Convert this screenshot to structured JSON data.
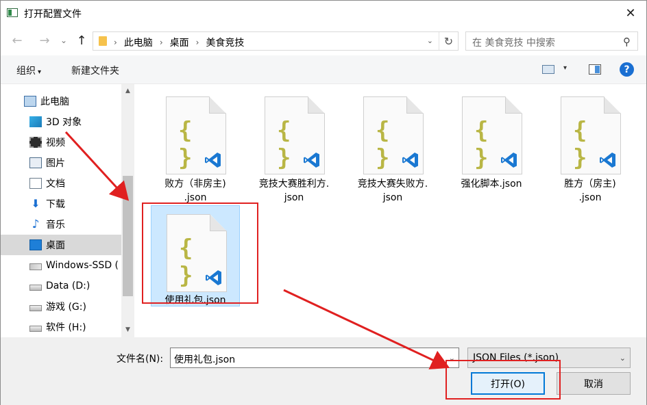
{
  "window": {
    "title": "打开配置文件",
    "close_glyph": "✕"
  },
  "nav": {
    "back_glyph": "←",
    "forward_glyph": "→",
    "recent_glyph": "⌄",
    "up_glyph": "↑",
    "breadcrumb": [
      "此电脑",
      "桌面",
      "美食竞技"
    ],
    "breadcrumb_sep": "›",
    "address_dropdown_glyph": "⌄",
    "refresh_glyph": "↻",
    "search_placeholder": "在 美食竞技 中搜索",
    "search_glyph": "⚲"
  },
  "toolbar": {
    "organize_label": "组织",
    "organize_arrow": "▾",
    "new_folder_label": "新建文件夹",
    "view_dropdown_glyph": "▾",
    "help_label": "?"
  },
  "sidebar": {
    "items": [
      {
        "label": "此电脑",
        "icon": "computer-icon"
      },
      {
        "label": "3D 对象",
        "icon": "3d-objects-icon"
      },
      {
        "label": "视频",
        "icon": "video-icon"
      },
      {
        "label": "图片",
        "icon": "pictures-icon"
      },
      {
        "label": "文档",
        "icon": "documents-icon"
      },
      {
        "label": "下载",
        "icon": "download-icon",
        "glyph": "⬇"
      },
      {
        "label": "音乐",
        "icon": "music-icon",
        "glyph": "♪"
      },
      {
        "label": "桌面",
        "icon": "desktop-icon",
        "selected": true
      },
      {
        "label": "Windows-SSD (",
        "icon": "windows-drive-icon"
      },
      {
        "label": "Data (D:)",
        "icon": "drive-icon"
      },
      {
        "label": "游戏 (G:)",
        "icon": "drive-icon"
      },
      {
        "label": "软件 (H:)",
        "icon": "drive-icon"
      }
    ],
    "scroll_up_glyph": "▲",
    "scroll_down_glyph": "▼"
  },
  "files": [
    {
      "name_line1": "败方（非房主)",
      "name_line2": ".json"
    },
    {
      "name_line1": "竞技大赛胜利方.",
      "name_line2": "json"
    },
    {
      "name_line1": "竞技大赛失败方.",
      "name_line2": "json"
    },
    {
      "name_line1": "强化脚本.json",
      "name_line2": ""
    },
    {
      "name_line1": "胜方（房主)",
      "name_line2": ".json"
    },
    {
      "name_line1": "使用礼包.json",
      "name_line2": "",
      "selected": true
    }
  ],
  "file_icon": {
    "braces": "{ }",
    "badge": "vscode-icon",
    "braces_color": "#b9b645",
    "badge_color": "#1a78d2"
  },
  "bottom": {
    "filename_label": "文件名(N):",
    "filename_value": "使用礼包.json",
    "filename_dropdown_glyph": "⌄",
    "filetype_value": "JSON Files (*.json)",
    "filetype_dropdown_glyph": "⌄",
    "open_label": "打开(O)",
    "cancel_label": "取消"
  },
  "annotation_color": "#e02020"
}
